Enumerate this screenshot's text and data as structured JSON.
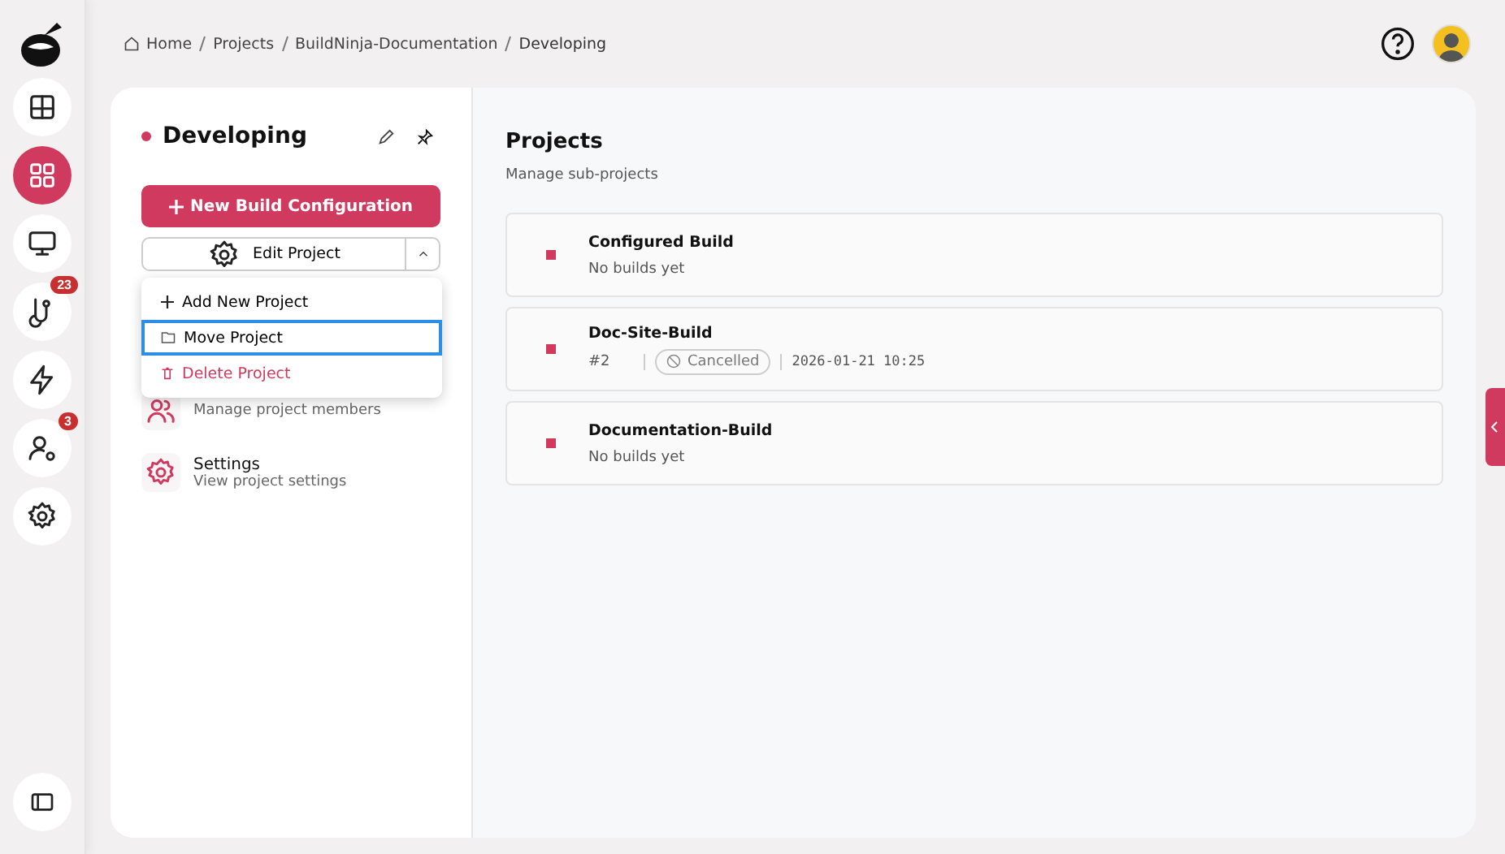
{
  "rail": {
    "items": [
      {
        "selected": false
      },
      {
        "selected": true
      },
      {
        "selected": false
      },
      {
        "selected": false,
        "badge": "23"
      },
      {
        "selected": false
      },
      {
        "selected": false,
        "badge": "3"
      },
      {
        "selected": false
      }
    ]
  },
  "breadcrumb": [
    "Home",
    "Projects",
    "BuildNinja-Documentation",
    "Developing"
  ],
  "project": {
    "title": "Developing",
    "primary_button": "New Build Configuration",
    "split_button": "Edit Project"
  },
  "menu": [
    {
      "kind": "add",
      "label": "Add New Project",
      "selected": false
    },
    {
      "kind": "move",
      "label": "Move Project",
      "selected": true
    },
    {
      "kind": "delete",
      "label": "Delete Project",
      "selected": false
    }
  ],
  "sections": [
    {
      "description": "Manage project members"
    },
    {
      "title": "Settings",
      "description": "View project settings"
    }
  ],
  "content": {
    "title": "Projects",
    "subtitle": "Manage sub-projects",
    "builds": [
      {
        "name": "Configured Build",
        "status": "No builds yet"
      },
      {
        "name": "Doc-Site-Build",
        "number": "#2",
        "badge": "Cancelled",
        "time": "2026-01-21 10:25"
      },
      {
        "name": "Documentation-Build",
        "status": "No builds yet"
      }
    ]
  }
}
